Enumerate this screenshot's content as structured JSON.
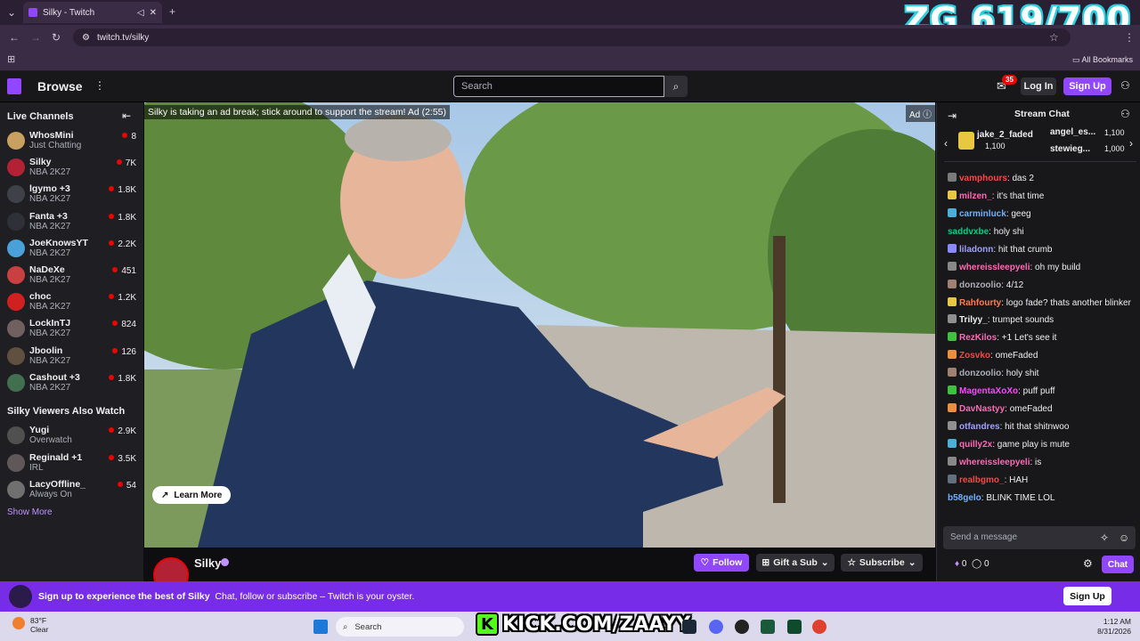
{
  "browser": {
    "tab_title": "Silky - Twitch",
    "url": "twitch.tv/silky",
    "bookmarks_label": "All Bookmarks"
  },
  "overlay": {
    "score": "ZG 619/700"
  },
  "twitch_nav": {
    "browse_label": "Browse",
    "search_placeholder": "Search",
    "notif_count": "35",
    "login_label": "Log In",
    "signup_label": "Sign Up"
  },
  "sidebar": {
    "live_header": "Live Channels",
    "channels": [
      {
        "name": "WhosMini",
        "game": "Just Chatting",
        "viewers": "8",
        "color": "#c8a060"
      },
      {
        "name": "Silky",
        "game": "NBA 2K27",
        "viewers": "7K",
        "color": "#b22234"
      },
      {
        "name": "lgymo +3",
        "game": "NBA 2K27",
        "viewers": "1.8K",
        "color": "#404048"
      },
      {
        "name": "Fanta +3",
        "game": "NBA 2K27",
        "viewers": "1.8K",
        "color": "#303038"
      },
      {
        "name": "JoeKnowsYT",
        "game": "NBA 2K27",
        "viewers": "2.2K",
        "color": "#4aa0d8"
      },
      {
        "name": "NaDeXe",
        "game": "NBA 2K27",
        "viewers": "451",
        "color": "#c84040"
      },
      {
        "name": "choc",
        "game": "NBA 2K27",
        "viewers": "1.2K",
        "color": "#d02020"
      },
      {
        "name": "LockInTJ",
        "game": "NBA 2K27",
        "viewers": "824",
        "color": "#706060"
      },
      {
        "name": "Jboolin",
        "game": "NBA 2K27",
        "viewers": "126",
        "color": "#605040"
      },
      {
        "name": "Cashout +3",
        "game": "NBA 2K27",
        "viewers": "1.8K",
        "color": "#407050"
      }
    ],
    "also_watch_header": "Silky Viewers Also Watch",
    "also_watch": [
      {
        "name": "Yugi",
        "game": "Overwatch",
        "viewers": "2.9K",
        "color": "#505050"
      },
      {
        "name": "Reginald +1",
        "game": "IRL",
        "viewers": "3.5K",
        "color": "#605858"
      },
      {
        "name": "LacyOffline_",
        "game": "Always On",
        "viewers": "54",
        "color": "#707070"
      }
    ],
    "show_more": "Show More"
  },
  "player": {
    "ad_message": "Silky is taking an ad break; stick around to support the stream! Ad (2:55)",
    "ad_tag": "Ad",
    "learn_more": "Learn More"
  },
  "stream_info": {
    "streamer": "Silky",
    "follow_label": "Follow",
    "gift_label": "Gift a Sub",
    "subscribe_label": "Subscribe"
  },
  "chat": {
    "title": "Stream Chat",
    "gifters": [
      {
        "name": "jake_2_faded",
        "amount": "1,100"
      },
      {
        "name": "angel_es...",
        "amount": "1,100"
      },
      {
        "name": "stewieg...",
        "amount": "1,000"
      }
    ],
    "messages": [
      {
        "user": "vamphours",
        "text": "das 2",
        "color": "#ff4444",
        "badge": "#7a7a7a"
      },
      {
        "user": "milzen_",
        "text": "it's that time",
        "color": "#ff69b4",
        "badge": "#e8c840"
      },
      {
        "user": "carminluck",
        "text": "geeg",
        "color": "#6fb0ff",
        "badge": "#4ab0d8"
      },
      {
        "user": "saddvxbe",
        "text": "holy shi",
        "color": "#00d084",
        "badge": ""
      },
      {
        "user": "liladonn",
        "text": "hit that crumb",
        "color": "#a0a0ff",
        "badge": "#8a8aff"
      },
      {
        "user": "whereissleepyeli",
        "text": "oh my build",
        "color": "#ff69b4",
        "badge": "#888888"
      },
      {
        "user": "donzoolio",
        "text": "4/12",
        "color": "#adadb8",
        "badge": "#a08070"
      },
      {
        "user": "Rahfourty",
        "text": "logo fade? thats another blinker",
        "color": "#ff7f50",
        "badge": "#e8c840",
        "wrap": true
      },
      {
        "user": "Trilyy_",
        "text": "trumpet sounds",
        "color": "#efeff1",
        "badge": "#909090"
      },
      {
        "user": "RezKilos",
        "text": "+1 Let's see it",
        "color": "#ff69b4",
        "badge": "#40c040"
      },
      {
        "user": "Zosvko",
        "text": "omeFaded",
        "color": "#ff4444",
        "badge": "#e89040"
      },
      {
        "user": "donzoolio",
        "text": "holy shit",
        "color": "#adadb8",
        "badge": "#a08070"
      },
      {
        "user": "MagentaXoXo",
        "text": "puff puff",
        "color": "#ff44ff",
        "badge": "#40c040"
      },
      {
        "user": "DavNastyy",
        "text": "omeFaded",
        "color": "#ff69b4",
        "badge": "#e89040"
      },
      {
        "user": "otfandres",
        "text": "hit that shitnwoo",
        "color": "#a0a0ff",
        "badge": "#909090"
      },
      {
        "user": "quilly2x",
        "text": "game play is mute",
        "color": "#ff69b4",
        "badge": "#4ab0d8"
      },
      {
        "user": "whereissleepyeli",
        "text": "is",
        "color": "#ff69b4",
        "badge": "#888888"
      },
      {
        "user": "realbgmo_",
        "text": "HAH",
        "color": "#ff4444",
        "badge": "#607080"
      },
      {
        "user": "b58gelo",
        "text": "BLINK TIME LOL",
        "color": "#6fb0ff",
        "badge": ""
      }
    ],
    "input_placeholder": "Send a message",
    "points_a": "0",
    "points_b": "0",
    "chat_button": "Chat"
  },
  "banner": {
    "text_bold": "Sign up to experience the best of Silky",
    "text": "Chat, follow or subscribe – Twitch is your oyster.",
    "signup_label": "Sign Up"
  },
  "taskbar": {
    "temp": "83°F",
    "condition": "Clear",
    "search_label": "Search",
    "kick_text": "KICK.COM/ZAAYY",
    "time": "1:12 AM",
    "date": "8/31/2026"
  }
}
